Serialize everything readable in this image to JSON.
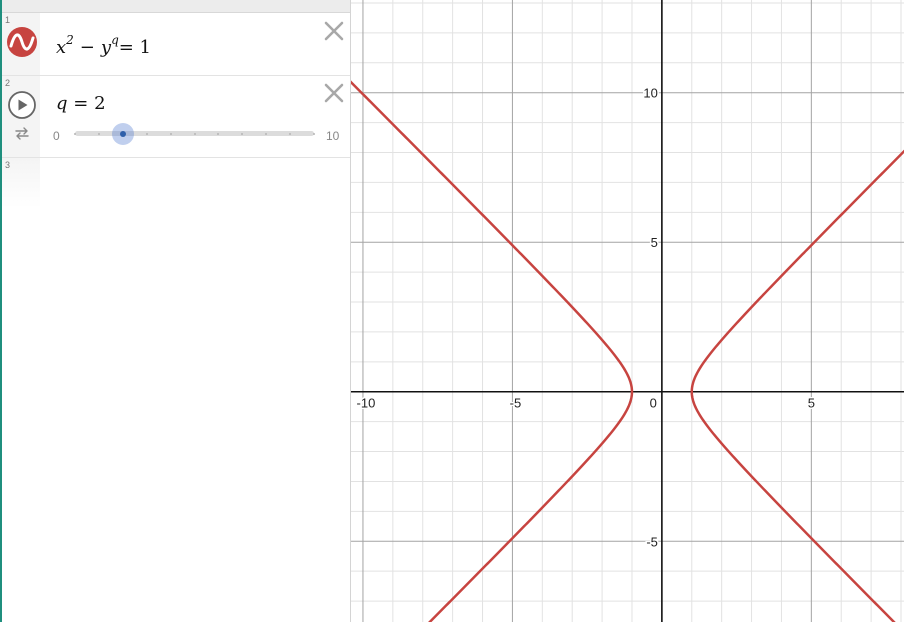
{
  "expressions": [
    {
      "index": "1",
      "lhs_base1": "x",
      "lhs_exp1": "2",
      "op": "−",
      "lhs_base2": "y",
      "lhs_exp2": "q",
      "rhs": "= 1",
      "icon": "graph-wave-icon",
      "color": "#c74440"
    },
    {
      "index": "2",
      "var": "q",
      "eq": "= 2",
      "icon": "play-icon",
      "secondary_icon": "loop-icon",
      "slider": {
        "min": "0",
        "max": "10",
        "value": 2
      }
    },
    {
      "index": "3"
    }
  ],
  "graph": {
    "xlim": [
      -10.4,
      8.1
    ],
    "ylim": [
      -7.7,
      13.1
    ],
    "curve_color": "#c74440",
    "x_ticks": [
      "-10",
      "-5",
      "0",
      "5"
    ],
    "y_ticks": [
      "10",
      "5",
      "-5"
    ]
  },
  "chart_data": {
    "type": "line",
    "title": "",
    "xlabel": "",
    "ylabel": "",
    "xlim": [
      -10.4,
      8.1
    ],
    "ylim": [
      -7.7,
      13.1
    ],
    "grid": true,
    "series": [
      {
        "values": "x^2 - y^2 = 1",
        "x": [
          -10,
          -8,
          -6,
          -4,
          -2,
          -1.5,
          -1,
          1,
          1.5,
          2,
          4,
          6,
          8
        ],
        "y_upper": [
          9.95,
          7.94,
          5.92,
          3.87,
          1.73,
          1.12,
          0,
          0,
          1.12,
          1.73,
          3.87,
          5.92,
          7.94
        ]
      }
    ]
  }
}
